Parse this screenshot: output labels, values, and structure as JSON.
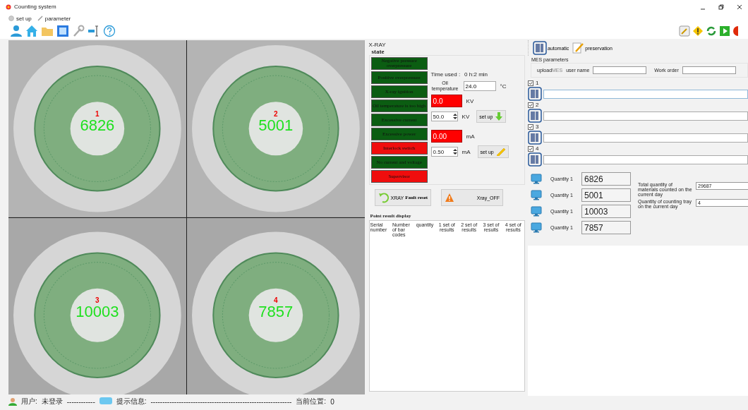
{
  "window": {
    "title": "Counting system"
  },
  "menu": [
    {
      "label": "set up"
    },
    {
      "label": "parameter"
    }
  ],
  "trays": [
    {
      "index": "1",
      "count": "6826"
    },
    {
      "index": "2",
      "count": "5001"
    },
    {
      "index": "3",
      "count": "10003"
    },
    {
      "index": "4",
      "count": "7857"
    }
  ],
  "xray": {
    "title": "X-RAY",
    "state_title": "state",
    "indicators": [
      {
        "label": "Negative pressure overpressure",
        "color": "#0b5d12"
      },
      {
        "label": "Positive overpressure",
        "color": "#0b5d12"
      },
      {
        "label": "X-ray ignition",
        "color": "#0b5d12"
      },
      {
        "label": "Oil temperature is too high",
        "color": "#0b5d12"
      },
      {
        "label": "Excessive current",
        "color": "#0b5d12"
      },
      {
        "label": "Excessive power",
        "color": "#0b5d12"
      },
      {
        "label": "Interlock switch",
        "color": "#f00d0d"
      },
      {
        "label": "No current and voltage",
        "color": "#0b5d12"
      },
      {
        "label": "Supervisor",
        "color": "#f00d0d"
      }
    ],
    "time_label": "Time used :",
    "time_value": "0 h:2 min",
    "oil_label": "Oil temperature",
    "oil_value": "24.0",
    "oil_unit": "°C",
    "kv_reading": "0.0",
    "kv_unit": "KV",
    "kv_set": "50.0",
    "kv_set_unit": "KV",
    "kv_button": "set up",
    "ma_reading": "0.00",
    "ma_unit": "mA",
    "ma_set": "0.50",
    "ma_set_unit": "mA",
    "ma_button": "set up",
    "reset_button": "XRAY**Fault reset**",
    "off_button": "Xray_OFF"
  },
  "point_result": {
    "title": "Point result display",
    "columns": [
      "Serial number",
      "Number of bar codes",
      "quantity",
      "1 set of results",
      "2 set of results",
      "3 set of results",
      "4 set of results"
    ]
  },
  "right_tabs": [
    {
      "label": "automatic"
    },
    {
      "label": "preservation"
    }
  ],
  "mes": {
    "title": "MES parameters",
    "upload": "upload",
    "upload_tag": "MES",
    "user_label": "user name",
    "order_label": "Work order"
  },
  "channels": [
    {
      "label": "1",
      "checked": true,
      "focused": true
    },
    {
      "label": "2",
      "checked": true,
      "focused": false
    },
    {
      "label": "3",
      "checked": true,
      "focused": false
    },
    {
      "label": "4",
      "checked": true,
      "focused": false
    }
  ],
  "quantities": [
    {
      "label": "Quantity 1",
      "value": "6826"
    },
    {
      "label": "Quantity 1",
      "value": "5001"
    },
    {
      "label": "Quantity 1",
      "value": "10003"
    },
    {
      "label": "Quantity 1",
      "value": "7857"
    }
  ],
  "totals": [
    {
      "label": "Total quantity of materials counted on the current day",
      "value": "29687"
    },
    {
      "label": "Quantity of counting tray on the current day",
      "value": "4"
    }
  ],
  "status_bar": {
    "user_label": "用户:",
    "user_value": "未登录",
    "sep1": "------------",
    "info_label": "提示信息:",
    "info_value": "------------------------------------------------------------",
    "pos_label": "当前位置:",
    "pos_value": "0"
  }
}
